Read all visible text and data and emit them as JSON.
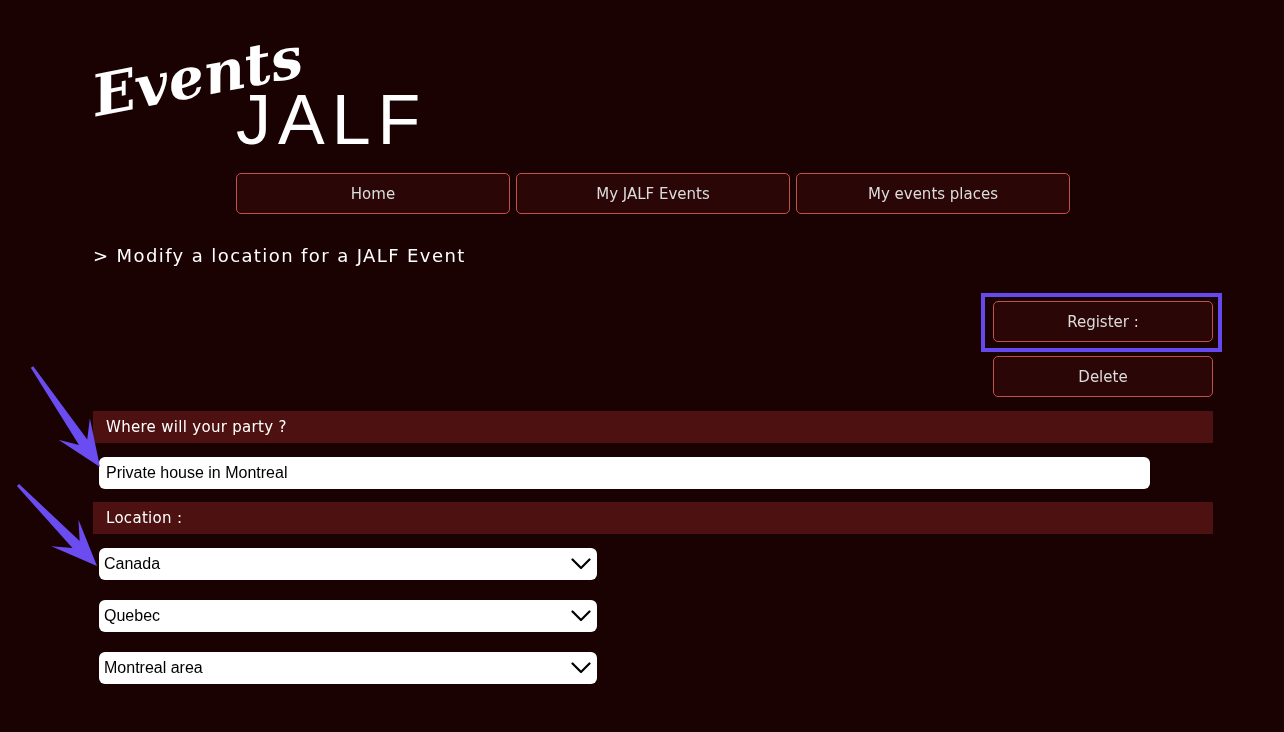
{
  "logo": {
    "script": "Events",
    "wordmark": "JALF"
  },
  "nav": [
    {
      "label": "Home"
    },
    {
      "label": "My JALF Events"
    },
    {
      "label": "My events places"
    }
  ],
  "page_title": "> Modify a location for a JALF Event",
  "actions": [
    {
      "label": "Register :",
      "highlighted": true
    },
    {
      "label": "Delete",
      "highlighted": false
    }
  ],
  "sections": [
    {
      "heading": "Where will your party ?",
      "fields": [
        {
          "kind": "text",
          "value": "Private house in Montreal",
          "pointed": true
        }
      ]
    },
    {
      "heading": "Location :",
      "fields": [
        {
          "kind": "select",
          "value": "Canada",
          "pointed": true
        },
        {
          "kind": "select",
          "value": "Quebec",
          "pointed": false
        },
        {
          "kind": "select",
          "value": "Montreal area",
          "pointed": false
        }
      ]
    }
  ]
}
